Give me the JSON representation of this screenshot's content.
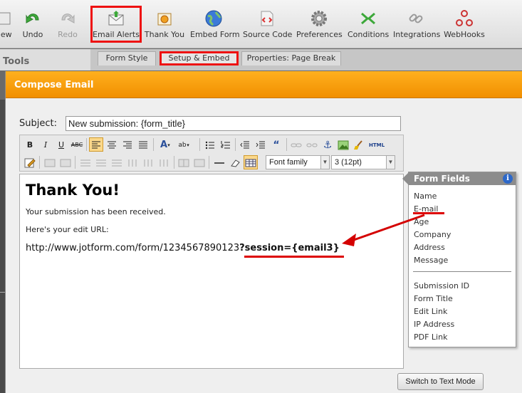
{
  "toolbar": {
    "buttons": [
      {
        "label": "view",
        "icon": "preview-icon"
      },
      {
        "label": "Undo",
        "icon": "undo-icon"
      },
      {
        "label": "Redo",
        "icon": "redo-icon"
      },
      {
        "label": "Email Alerts",
        "icon": "email-alerts-icon"
      },
      {
        "label": "Thank You",
        "icon": "thank-you-icon"
      },
      {
        "label": "Embed Form",
        "icon": "globe-icon"
      },
      {
        "label": "Source Code",
        "icon": "source-code-icon"
      },
      {
        "label": "Preferences",
        "icon": "gear-icon"
      },
      {
        "label": "Conditions",
        "icon": "conditions-icon"
      },
      {
        "label": "Integrations",
        "icon": "integrations-icon"
      },
      {
        "label": "WebHooks",
        "icon": "webhooks-icon"
      }
    ]
  },
  "left_panel": {
    "title": "Tools"
  },
  "tabs": [
    {
      "label": "Form Style"
    },
    {
      "label": "Setup & Embed"
    },
    {
      "label": "Properties: Page Break"
    }
  ],
  "modal": {
    "title": "Compose Email",
    "subject_label": "Subject:",
    "subject_value": "New submission: {form_title}",
    "font_family": "Font family",
    "font_size": "3 (12pt)",
    "switch_button": "Switch to Text Mode"
  },
  "editor": {
    "heading": "Thank You!",
    "line1": "Your submission has been received.",
    "line2": "Here's your edit URL:",
    "url_plain": "http://www.jotform.com/form/1234567890123",
    "url_bold": "?session={email3}"
  },
  "form_fields": {
    "title": "Form Fields",
    "info": "i",
    "fields": [
      "Name",
      "E-mail",
      "Age",
      "Company",
      "Address",
      "Message"
    ],
    "system_fields": [
      "Submission ID",
      "Form Title",
      "Edit Link",
      "IP Address",
      "PDF Link"
    ]
  },
  "colors": {
    "accent_orange": "#f39a00",
    "highlight_red": "#dd1111",
    "info_blue": "#2d68c8"
  }
}
